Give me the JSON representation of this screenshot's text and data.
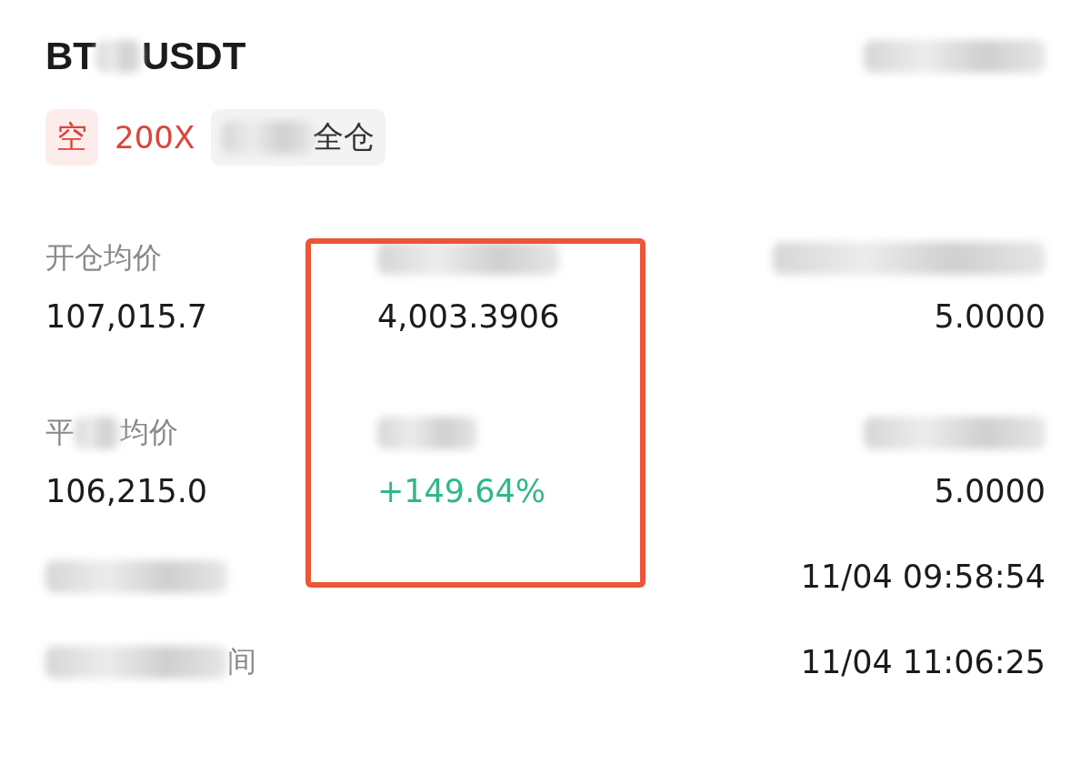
{
  "title": [
    {
      "kind": "text",
      "text": "BT"
    },
    {
      "kind": "blur"
    },
    {
      "kind": "text",
      "text": "USDT"
    }
  ],
  "header_right": [
    {
      "kind": "blur"
    }
  ],
  "tags": [
    {
      "kind": "side",
      "text": "空"
    },
    {
      "kind": "leverage",
      "text": "200X"
    },
    {
      "kind": "margin",
      "segments": [
        {
          "kind": "blur"
        },
        {
          "kind": "text",
          "text": "全仓"
        }
      ]
    }
  ],
  "stats": [
    {
      "label": [
        {
          "kind": "text",
          "text": "开仓均价"
        }
      ],
      "value": "107,015.7",
      "gain": false
    },
    {
      "label": [
        {
          "kind": "blur"
        }
      ],
      "value": "4,003.3906",
      "gain": false
    },
    {
      "label": [
        {
          "kind": "blur"
        }
      ],
      "value": "5.0000",
      "gain": false
    },
    {
      "label": [
        {
          "kind": "text",
          "text": "平"
        },
        {
          "kind": "blur"
        },
        {
          "kind": "text",
          "text": "均价"
        }
      ],
      "value": "106,215.0",
      "gain": false
    },
    {
      "label": [
        {
          "kind": "blur"
        }
      ],
      "value": "+149.64%",
      "gain": true
    },
    {
      "label": [
        {
          "kind": "blur"
        }
      ],
      "value": "5.0000",
      "gain": false
    }
  ],
  "details": [
    {
      "label": [
        {
          "kind": "blur"
        }
      ],
      "value": "11/04 09:58:54"
    },
    {
      "label": [
        {
          "kind": "blur"
        },
        {
          "kind": "text",
          "text": "间"
        }
      ],
      "value": "11/04 11:06:25"
    }
  ],
  "highlight_frame": true
}
